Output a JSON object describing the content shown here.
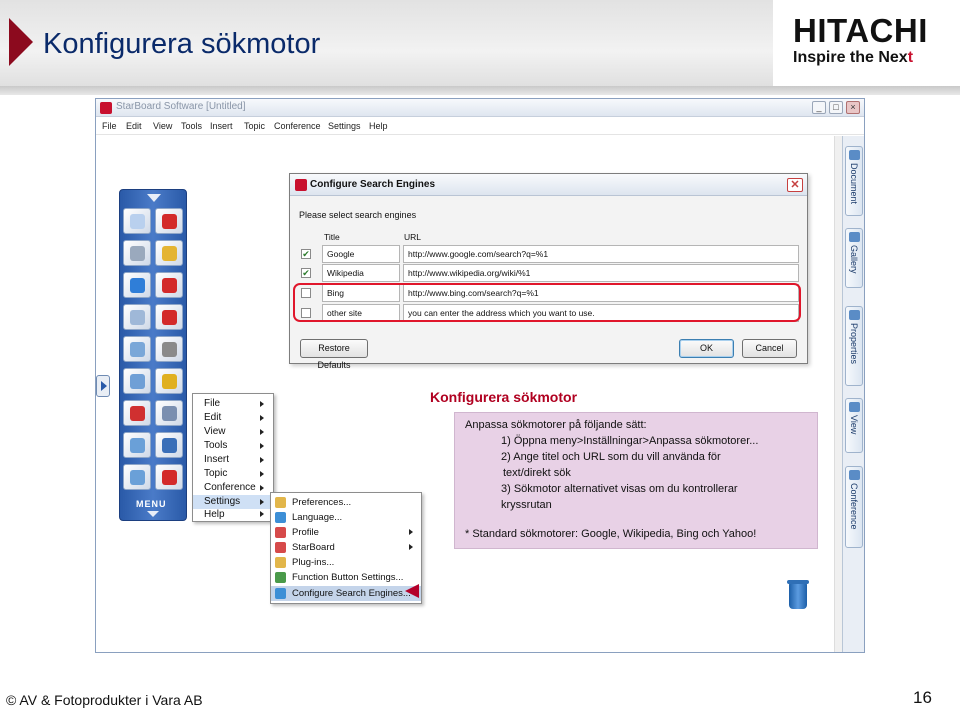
{
  "slide": {
    "title": "Konfigurera sökmotor",
    "logo_name": "HITACHI",
    "logo_tagline": "Inspire the Nex",
    "logo_tagline_end": "t",
    "copyright": "© AV & Fotoprodukter i Vara AB",
    "page_number": "16"
  },
  "app": {
    "title": "StarBoard Software [Untitled]",
    "menu": [
      "File",
      "Edit",
      "View",
      "Tools",
      "Insert",
      "Topic",
      "Conference",
      "Settings",
      "Help"
    ],
    "side_tabs": [
      "Document",
      "Gallery",
      "Properties",
      "View",
      "Conference"
    ],
    "toolbar_label": "MENU"
  },
  "main_menu": {
    "items": [
      "File",
      "Edit",
      "View",
      "Tools",
      "Insert",
      "Topic",
      "Conference",
      "Settings",
      "Help"
    ],
    "selected": "Settings"
  },
  "settings_menu": {
    "items": [
      "Preferences...",
      "Language...",
      "Profile",
      "StarBoard",
      "Plug-ins...",
      "Function Button Settings...",
      "Configure Search Engines..."
    ],
    "selected": "Configure Search Engines..."
  },
  "dialog": {
    "title": "Configure Search Engines",
    "prompt": "Please select search engines",
    "col_title": "Title",
    "col_url": "URL",
    "engines": [
      {
        "checked": true,
        "title": "Google",
        "url": "http://www.google.com/search?q=%1"
      },
      {
        "checked": true,
        "title": "Wikipedia",
        "url": "http://www.wikipedia.org/wiki/%1"
      },
      {
        "checked": false,
        "title": "Bing",
        "url": "http://www.bing.com/search?q=%1"
      },
      {
        "checked": false,
        "title": "other site",
        "url": "you can enter the address which you want to use."
      }
    ],
    "restore_label": "Restore Defaults",
    "ok_label": "OK",
    "cancel_label": "Cancel",
    "close_glyph": "✕",
    "check_glyph": "✔"
  },
  "callout": {
    "heading": "Konfigurera sökmotor",
    "lines": [
      "Anpassa sökmotorer på följande sätt:",
      "1) Öppna meny>Inställningar>Anpassa sökmotorer...",
      "2) Ange titel och URL som du vill använda för",
      "text/direkt sök",
      "3) Sökmotor alternativet visas om du kontrollerar",
      "kryssrutan",
      "* Standard sökmotorer: Google, Wikipedia, Bing och Yahoo!"
    ]
  },
  "colors": {
    "accent": "#b00020",
    "callout_bg": "#e8d1e6",
    "toolbar": "#2a5aa8"
  }
}
